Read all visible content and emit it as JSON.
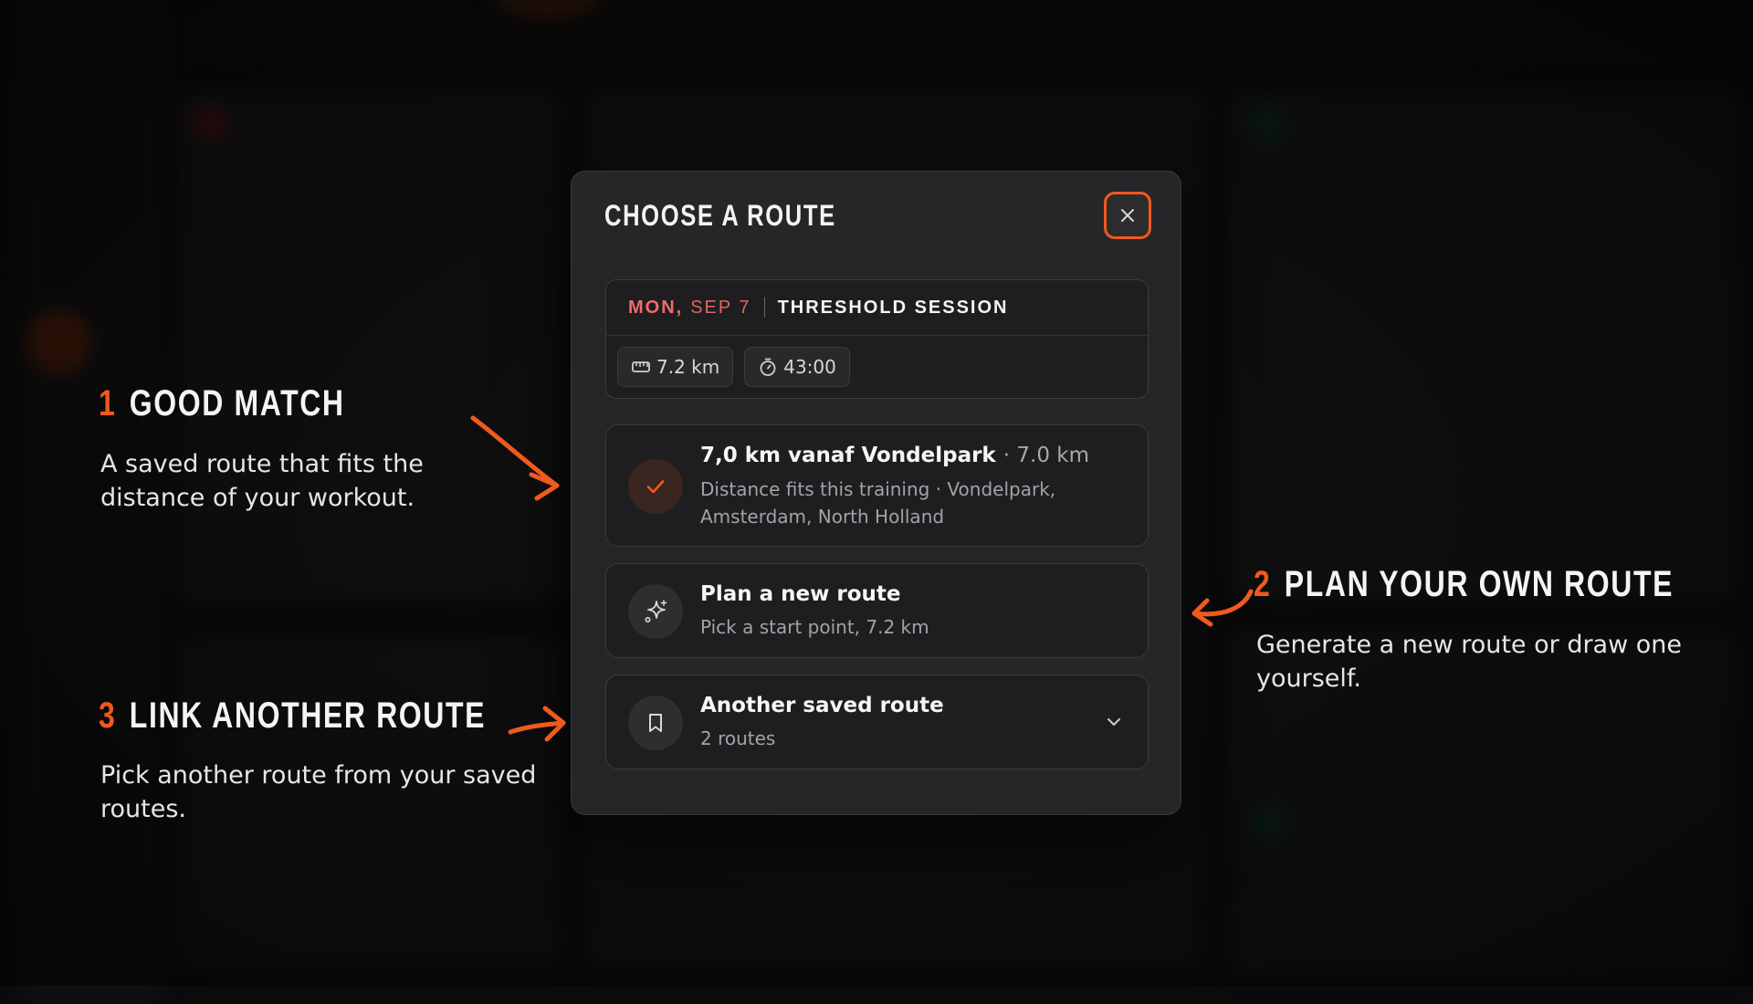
{
  "modal": {
    "title": "CHOOSE A ROUTE",
    "close_icon": "close-icon"
  },
  "session": {
    "day": "MON,",
    "date": "SEP 7",
    "name": "THRESHOLD SESSION",
    "distance": "7.2 km",
    "duration": "43:00",
    "distance_icon": "ruler-icon",
    "duration_icon": "stopwatch-icon"
  },
  "options": {
    "good_match": {
      "title": "7,0 km vanaf Vondelpark",
      "distance": "· 7.0 km",
      "subtitle": "Distance fits this training · Vondelpark, Amsterdam, North Holland",
      "icon": "check-icon"
    },
    "plan_new": {
      "title": "Plan a new route",
      "subtitle": "Pick a start point, 7.2 km",
      "icon": "sparkle-icon"
    },
    "another_saved": {
      "title": "Another saved route",
      "subtitle": "2 routes",
      "icon": "bookmark-icon",
      "expand_icon": "chevron-down-icon"
    }
  },
  "annotations": {
    "one": {
      "number": "1",
      "heading": "GOOD MATCH",
      "text": "A saved route that fits the distance of your workout."
    },
    "two": {
      "number": "2",
      "heading": "PLAN YOUR OWN ROUTE",
      "text": "Generate a new route or draw one yourself."
    },
    "three": {
      "number": "3",
      "heading": "LINK ANOTHER ROUTE",
      "text": "Pick another route from your saved routes."
    }
  },
  "colors": {
    "accent": "#f05a1e",
    "day": "#f06a6a",
    "modal_bg": "#262628",
    "page_bg": "#0b0b0c"
  }
}
